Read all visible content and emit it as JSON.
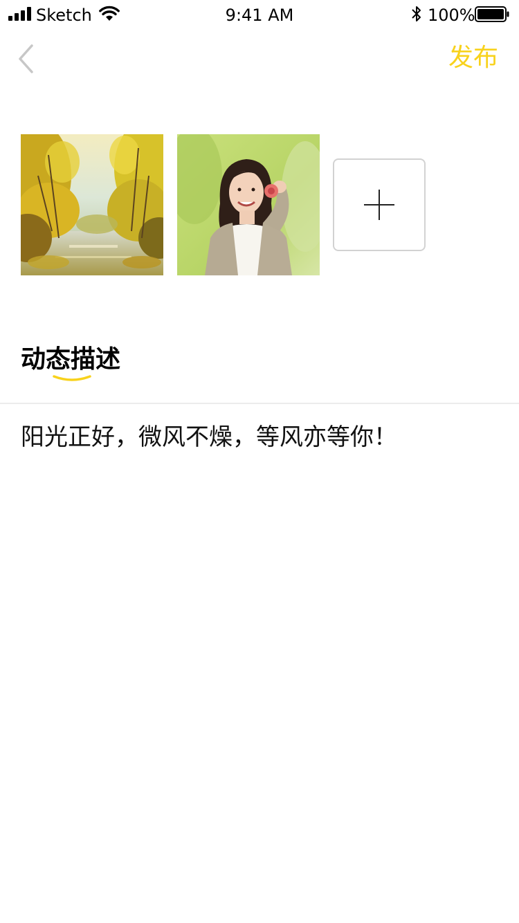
{
  "status_bar": {
    "carrier": "Sketch",
    "time": "9:41 AM",
    "battery_percent": "100%",
    "signal_icon": "signal-bars-icon",
    "wifi_icon": "wifi-icon",
    "bluetooth_icon": "bluetooth-icon",
    "battery_icon": "battery-full-icon"
  },
  "nav": {
    "back_icon": "chevron-left-icon",
    "publish_label": "发布",
    "accent_color": "#f8d21c"
  },
  "photos": {
    "items": [
      {
        "name": "autumn-lake-painting"
      },
      {
        "name": "smiling-girl-portrait"
      }
    ],
    "add_icon": "plus-icon"
  },
  "description": {
    "title": "动态描述",
    "text": "阳光正好，微风不燥，等风亦等你！"
  }
}
